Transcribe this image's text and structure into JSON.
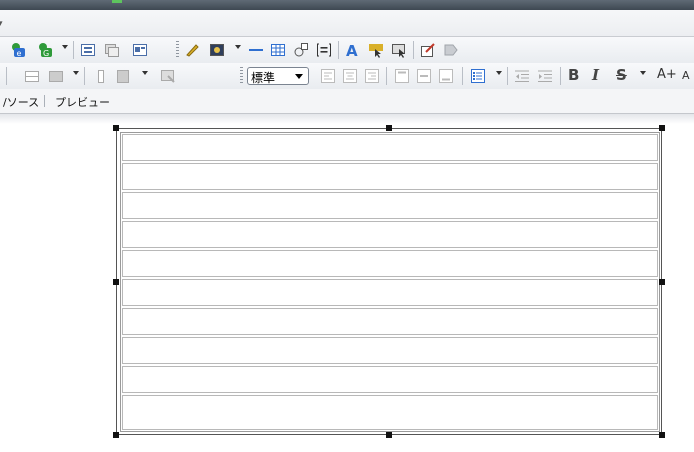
{
  "editor": {
    "block_format": "標準",
    "text_style": {
      "bold_label": "B",
      "italic_label": "I",
      "strike_label": "S",
      "grow_font_label": "A+",
      "shrink_font_label": "A"
    },
    "tabs": [
      {
        "label": "/ソース"
      },
      {
        "label": "プレビュー"
      }
    ],
    "table": {
      "rows": 10
    }
  },
  "colors": {
    "accent_blue": "#2f6fd0",
    "icon_green": "#2f9a3a",
    "pencil_yellow": "#d9b02a"
  }
}
